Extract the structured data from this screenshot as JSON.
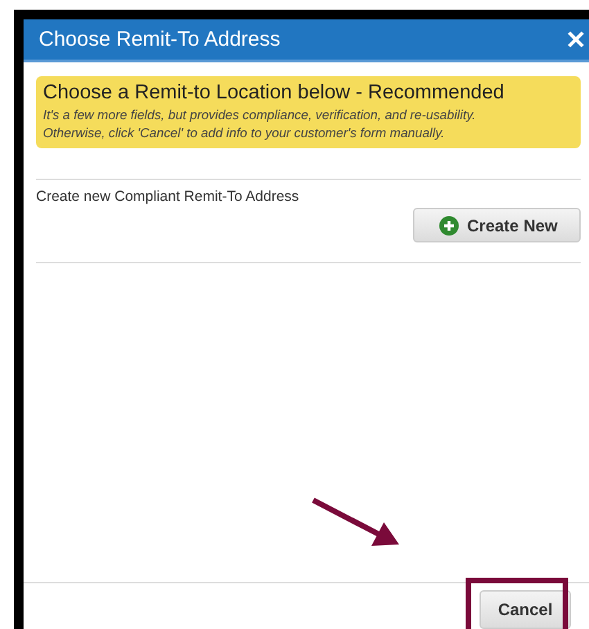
{
  "window": {
    "title": "Choose Remit-To Address",
    "close": "✕"
  },
  "notice": {
    "heading": "Choose a Remit-to Location below - Recommended",
    "lines": [
      "It's a few more fields, but provides compliance, verification, and re-usability.",
      "Otherwise, click 'Cancel' to add info to your customer's form manually."
    ]
  },
  "create": {
    "label": "Create new Compliant Remit-To Address",
    "button": "Create New"
  },
  "footer": {
    "buttons": [
      "Cancel"
    ]
  }
}
